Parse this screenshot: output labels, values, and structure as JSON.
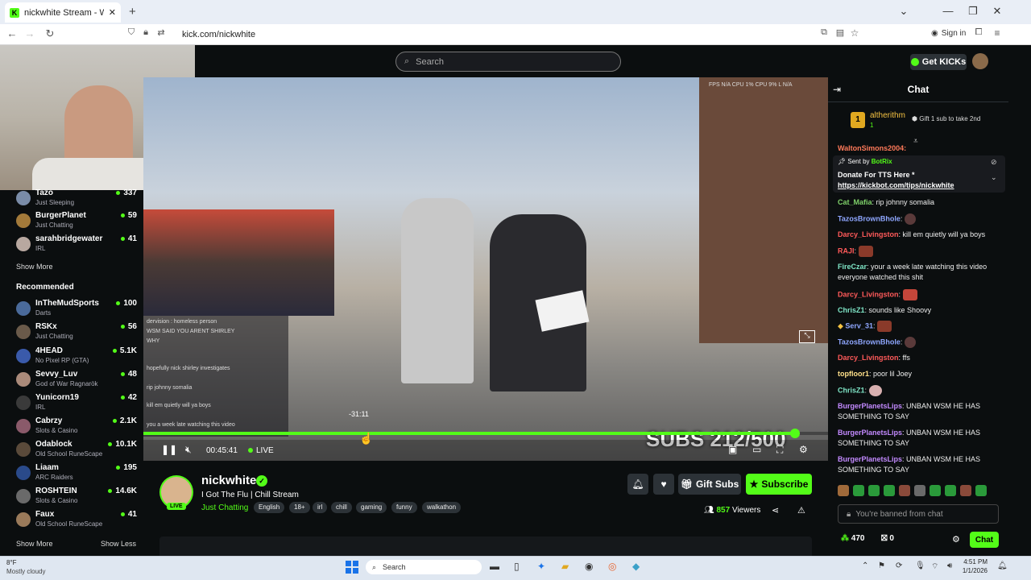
{
  "browser": {
    "tab_title": "nickwhite Stream - Watch Live o",
    "url": "kick.com/nickwhite",
    "sign_in": "Sign in"
  },
  "header": {
    "search_placeholder": "Search",
    "get_kicks": "Get KICKs"
  },
  "sidebar": {
    "following": [
      {
        "name": "Tazo",
        "category": "Just Sleeping",
        "viewers": "337"
      },
      {
        "name": "BurgerPlanet",
        "category": "Just Chatting",
        "viewers": "59"
      },
      {
        "name": "sarahbridgewater",
        "category": "IRL",
        "viewers": "41"
      }
    ],
    "show_more_1": "Show More",
    "recommended_label": "Recommended",
    "recommended": [
      {
        "name": "InTheMudSports",
        "category": "Darts",
        "viewers": "100"
      },
      {
        "name": "RSKx",
        "category": "Just Chatting",
        "viewers": "56"
      },
      {
        "name": "4HEAD",
        "category": "No Pixel RP (GTA)",
        "viewers": "5.1K"
      },
      {
        "name": "Sevvy_Luv",
        "category": "God of War Ragnarök",
        "viewers": "48"
      },
      {
        "name": "Yunicorn19",
        "category": "IRL",
        "viewers": "42"
      },
      {
        "name": "Cabrzy",
        "category": "Slots & Casino",
        "viewers": "2.1K"
      },
      {
        "name": "Odablock",
        "category": "Old School RuneScape",
        "viewers": "10.1K"
      },
      {
        "name": "Liaam",
        "category": "ARC Raiders",
        "viewers": "195"
      },
      {
        "name": "ROSHTEIN",
        "category": "Slots & Casino",
        "viewers": "14.6K"
      },
      {
        "name": "Faux",
        "category": "Old School RuneScape",
        "viewers": "41"
      }
    ],
    "show_more_2": "Show More",
    "show_less": "Show Less"
  },
  "player": {
    "elapsed": "00:45:41",
    "live_label": "LIVE",
    "hover_time": "-31:11",
    "subs_overlay": "SUBS 212/500",
    "progress": 0.952,
    "stats": "FPS N/A   CPU 1%   CPU 9%   L N/A",
    "overlay_chat": [
      "dervision : homeless person",
      "WSM SAID YOU ARENT SHIRLEY",
      "WHY",
      "hopefully nick shirley investigates",
      "rip johnny somalia",
      "kill em quietly will ya boys",
      "you a week late watching this video"
    ]
  },
  "stream": {
    "name": "nickwhite",
    "live_badge": "LIVE",
    "title": "I Got The Flu | Chill Stream",
    "category": "Just Chatting",
    "tags": [
      "English",
      "18+",
      "irl",
      "chill",
      "gaming",
      "funny",
      "walkathon"
    ],
    "gift_subs": "Gift Subs",
    "subscribe": "Subscribe",
    "viewer_count": "857",
    "viewers_label": "Viewers"
  },
  "chat": {
    "title": "Chat",
    "top_gifter": "altherithm",
    "top_gifter_count": "1",
    "gift_prompt": "Gift 1 sub to take 2nd",
    "truncated_user": "WaltonSimons2004:",
    "pinned_sent_by": "Sent by",
    "pinned_bot": "BotRix",
    "pinned_text": "Donate For TTS Here * ",
    "pinned_link": "https://kickbot.com/tips/nickwhite",
    "messages": [
      {
        "user": "Cat_Mafia",
        "text": "rip johnny somalia",
        "color": "#7fd16a"
      },
      {
        "user": "TazosBrownBhole",
        "text": "",
        "color": "#8fa7ff"
      },
      {
        "user": "Darcy_Livingston",
        "text": "kill em quietly will ya boys",
        "color": "#ff5a5a"
      },
      {
        "user": "RAJI",
        "text": "",
        "color": "#ff5a5a"
      },
      {
        "user": "FireCzar",
        "text": "your a week late watching this video everyone watched this shit",
        "color": "#7fe6c7"
      },
      {
        "user": "Darcy_Livingston",
        "text": "",
        "color": "#ff5a5a"
      },
      {
        "user": "ChrisZ1",
        "text": "sounds like Shoovy",
        "color": "#7fe6c7"
      },
      {
        "user": "Serv_31",
        "text": "",
        "color": "#8fa7ff"
      },
      {
        "user": "TazosBrownBhole",
        "text": "",
        "color": "#8fa7ff"
      },
      {
        "user": "Darcy_Livingston",
        "text": "ffs",
        "color": "#ff5a5a"
      },
      {
        "user": "topfloor1",
        "text": "poor lil Joey",
        "color": "#ffe08a"
      },
      {
        "user": "ChrisZ1",
        "text": "",
        "color": "#7fe6c7"
      },
      {
        "user": "BurgerPlanetsLips",
        "text": "UNBAN WSM HE HAS SOMETHING TO SAY",
        "color": "#c38aff"
      },
      {
        "user": "BurgerPlanetsLips",
        "text": "UNBAN WSM HE HAS SOMETHING TO SAY",
        "color": "#c38aff"
      },
      {
        "user": "BurgerPlanetsLips",
        "text": "UNBAN WSM HE HAS SOMETHING TO SAY",
        "color": "#c38aff"
      }
    ],
    "banned_placeholder": "You're banned from chat",
    "points": "470",
    "gifts": "0",
    "send": "Chat"
  },
  "taskbar": {
    "temp": "8°F",
    "weather": "Mostly cloudy",
    "search": "Search",
    "time": "4:51 PM",
    "date": "1/1/2026"
  },
  "colors": {
    "accent": "#53fc18",
    "background": "#0b0e0f",
    "surface": "#2c3237"
  }
}
